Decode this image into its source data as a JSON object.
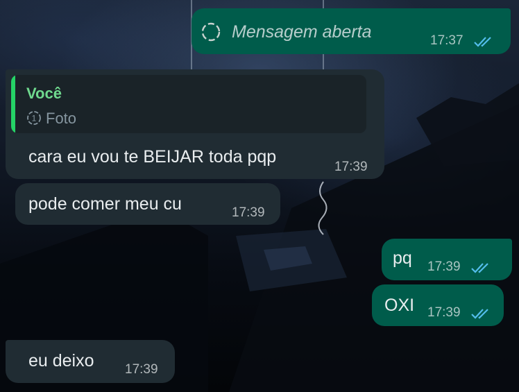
{
  "messages": [
    {
      "direction": "outgoing",
      "text": "Mensagem aberta",
      "time": "17:37",
      "status": "read",
      "view_once_opened": true
    },
    {
      "direction": "incoming",
      "quote": {
        "author": "Você",
        "media_label": "Foto"
      },
      "text": "cara eu vou te BEIJAR toda pqp",
      "time": "17:39"
    },
    {
      "direction": "incoming",
      "text": "pode comer meu cu",
      "time": "17:39"
    },
    {
      "direction": "outgoing",
      "text": "pq",
      "time": "17:39",
      "status": "read"
    },
    {
      "direction": "outgoing",
      "text": "OXI",
      "time": "17:39",
      "status": "read"
    },
    {
      "direction": "incoming",
      "text": "eu deixo",
      "time": "17:39"
    }
  ],
  "colors": {
    "incoming_bubble": "#202c33",
    "outgoing_bubble": "#005c4b",
    "read_ticks": "#53bdeb",
    "quote_bar": "#25d366",
    "quote_author": "#6fd98e"
  },
  "icons": {
    "view_once_opened": "dashed-circle-icon",
    "view_once_photo": "view-once-1-icon",
    "read_status": "double-check-icon"
  }
}
